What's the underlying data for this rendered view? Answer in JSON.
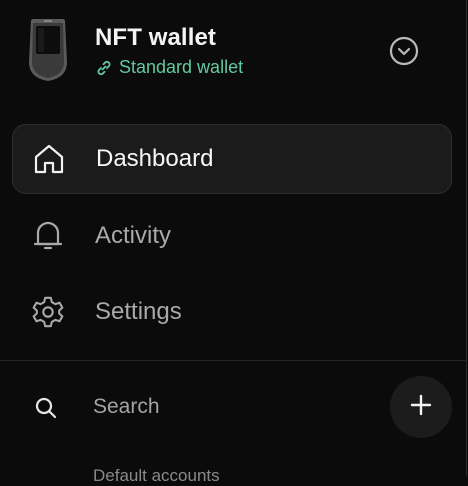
{
  "wallet": {
    "name": "NFT wallet",
    "type": "Standard wallet",
    "device_icon": "hardware-wallet-device",
    "expand_icon": "chevron-down-circle-icon"
  },
  "nav": {
    "items": [
      {
        "label": "Dashboard",
        "icon": "home-icon",
        "active": true
      },
      {
        "label": "Activity",
        "icon": "bell-icon",
        "active": false
      },
      {
        "label": "Settings",
        "icon": "gear-icon",
        "active": false
      }
    ]
  },
  "search": {
    "placeholder": "Search",
    "add_icon": "plus-icon"
  },
  "sections": {
    "next_header": "Default accounts"
  },
  "colors": {
    "background": "#0b0b0b",
    "active_item": "#1b1b1b",
    "accent_green": "#63c9a2",
    "text_primary": "#f2f2f2",
    "text_muted": "#a9a9a9"
  }
}
